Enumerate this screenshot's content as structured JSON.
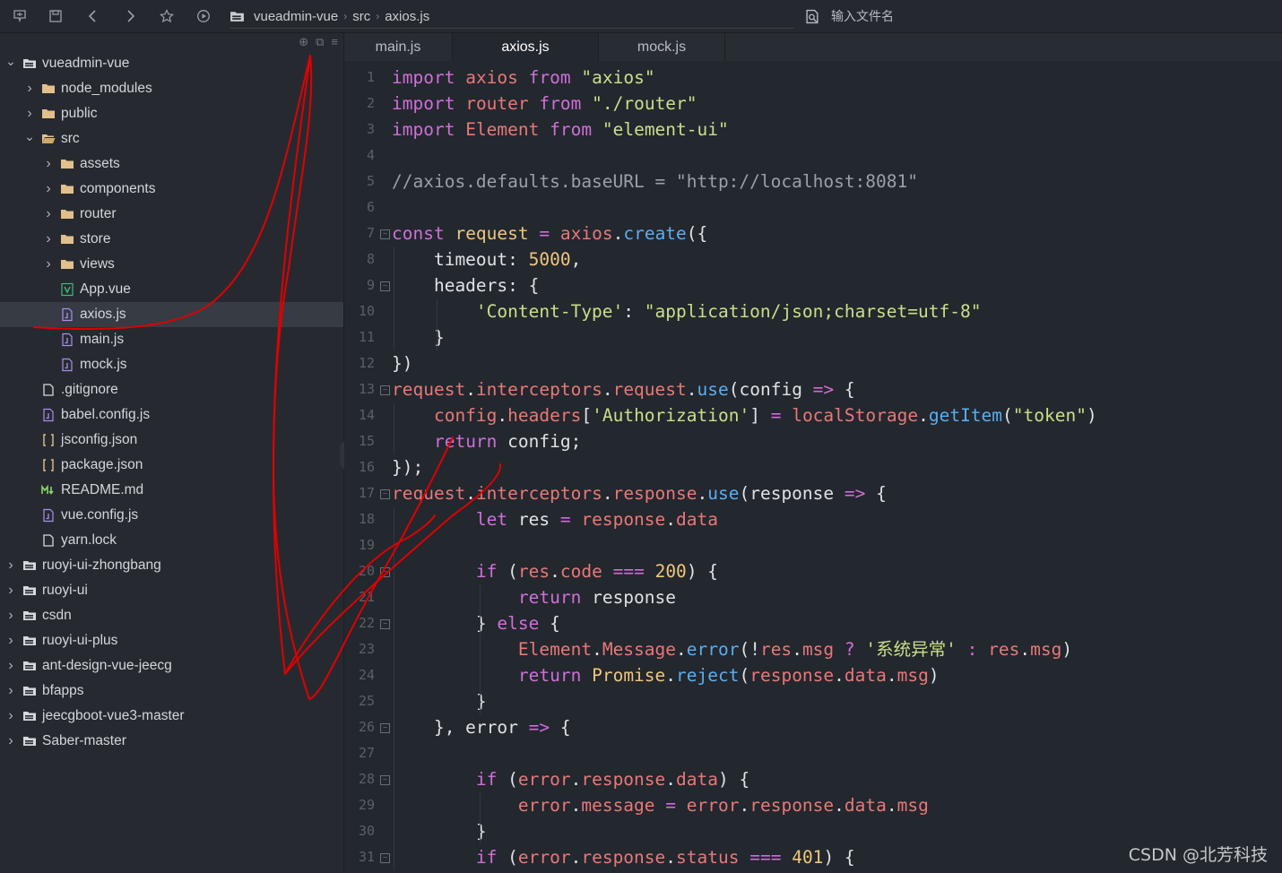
{
  "toolbar": {
    "path": [
      "vueadmin-vue",
      "src",
      "axios.js"
    ],
    "search_placeholder": "输入文件名"
  },
  "sidebar": {
    "tree": [
      {
        "label": "vueadmin-vue",
        "type": "project",
        "expanded": true,
        "level": 0
      },
      {
        "label": "node_modules",
        "type": "folder",
        "expanded": false,
        "level": 1
      },
      {
        "label": "public",
        "type": "folder",
        "expanded": false,
        "level": 1
      },
      {
        "label": "src",
        "type": "folder-open",
        "expanded": true,
        "level": 1
      },
      {
        "label": "assets",
        "type": "folder",
        "expanded": false,
        "level": 2
      },
      {
        "label": "components",
        "type": "folder",
        "expanded": false,
        "level": 2
      },
      {
        "label": "router",
        "type": "folder",
        "expanded": false,
        "level": 2
      },
      {
        "label": "store",
        "type": "folder",
        "expanded": false,
        "level": 2
      },
      {
        "label": "views",
        "type": "folder",
        "expanded": false,
        "level": 2
      },
      {
        "label": "App.vue",
        "type": "vue",
        "level": 2
      },
      {
        "label": "axios.js",
        "type": "js",
        "level": 2,
        "selected": true
      },
      {
        "label": "main.js",
        "type": "js",
        "level": 2
      },
      {
        "label": "mock.js",
        "type": "js",
        "level": 2
      },
      {
        "label": ".gitignore",
        "type": "file",
        "level": 1
      },
      {
        "label": "babel.config.js",
        "type": "js",
        "level": 1
      },
      {
        "label": "jsconfig.json",
        "type": "json",
        "level": 1
      },
      {
        "label": "package.json",
        "type": "json",
        "level": 1
      },
      {
        "label": "README.md",
        "type": "md",
        "level": 1
      },
      {
        "label": "vue.config.js",
        "type": "js",
        "level": 1
      },
      {
        "label": "yarn.lock",
        "type": "file",
        "level": 1
      },
      {
        "label": "ruoyi-ui-zhongbang",
        "type": "project",
        "expanded": false,
        "level": 0
      },
      {
        "label": "ruoyi-ui",
        "type": "project",
        "expanded": false,
        "level": 0
      },
      {
        "label": "csdn",
        "type": "project",
        "expanded": false,
        "level": 0
      },
      {
        "label": "ruoyi-ui-plus",
        "type": "project",
        "expanded": false,
        "level": 0
      },
      {
        "label": "ant-design-vue-jeecg",
        "type": "project",
        "expanded": false,
        "level": 0
      },
      {
        "label": "bfapps",
        "type": "project",
        "expanded": false,
        "level": 0
      },
      {
        "label": "jeecgboot-vue3-master",
        "type": "project",
        "expanded": false,
        "level": 0
      },
      {
        "label": "Saber-master",
        "type": "project",
        "expanded": false,
        "level": 0
      }
    ]
  },
  "tabs": [
    {
      "label": "main.js",
      "active": false
    },
    {
      "label": "axios.js",
      "active": true
    },
    {
      "label": "mock.js",
      "active": false
    }
  ],
  "code": {
    "lines": [
      {
        "n": "1",
        "fold": false,
        "tokens": [
          [
            "kw",
            "import"
          ],
          [
            "pl",
            " "
          ],
          [
            "vr",
            "axios"
          ],
          [
            "pl",
            " "
          ],
          [
            "fr",
            "from"
          ],
          [
            "pl",
            " "
          ],
          [
            "st",
            "\"axios\""
          ]
        ]
      },
      {
        "n": "2",
        "fold": false,
        "tokens": [
          [
            "kw",
            "import"
          ],
          [
            "pl",
            " "
          ],
          [
            "vr",
            "router"
          ],
          [
            "pl",
            " "
          ],
          [
            "fr",
            "from"
          ],
          [
            "pl",
            " "
          ],
          [
            "st",
            "\"./router\""
          ]
        ]
      },
      {
        "n": "3",
        "fold": false,
        "tokens": [
          [
            "kw",
            "import"
          ],
          [
            "pl",
            " "
          ],
          [
            "vr",
            "Element"
          ],
          [
            "pl",
            " "
          ],
          [
            "fr",
            "from"
          ],
          [
            "pl",
            " "
          ],
          [
            "st",
            "\"element-ui\""
          ]
        ]
      },
      {
        "n": "4",
        "fold": false,
        "tokens": []
      },
      {
        "n": "5",
        "fold": false,
        "tokens": [
          [
            "cm",
            "//axios.defaults.baseURL = \"http://localhost:8081\""
          ]
        ]
      },
      {
        "n": "6",
        "fold": false,
        "tokens": []
      },
      {
        "n": "7",
        "fold": true,
        "tokens": [
          [
            "kw",
            "const"
          ],
          [
            "pl",
            " "
          ],
          [
            "nm",
            "request"
          ],
          [
            "pl",
            " "
          ],
          [
            "op",
            "="
          ],
          [
            "pl",
            " "
          ],
          [
            "vr",
            "axios"
          ],
          [
            "pl",
            "."
          ],
          [
            "fn",
            "create"
          ],
          [
            "pl",
            "({"
          ]
        ]
      },
      {
        "n": "8",
        "fold": false,
        "tokens": [
          [
            "pl",
            "    timeout: "
          ],
          [
            "nm",
            "5000"
          ],
          [
            "pl",
            ","
          ]
        ]
      },
      {
        "n": "9",
        "fold": true,
        "tokens": [
          [
            "pl",
            "    headers: {"
          ]
        ]
      },
      {
        "n": "10",
        "fold": false,
        "tokens": [
          [
            "pl",
            "        "
          ],
          [
            "st",
            "'Content-Type'"
          ],
          [
            "pl",
            ": "
          ],
          [
            "st",
            "\"application/json;charset=utf-8\""
          ]
        ]
      },
      {
        "n": "11",
        "fold": false,
        "tokens": [
          [
            "pl",
            "    }"
          ]
        ]
      },
      {
        "n": "12",
        "fold": false,
        "tokens": [
          [
            "pl",
            "})"
          ]
        ]
      },
      {
        "n": "13",
        "fold": true,
        "tokens": [
          [
            "vr",
            "request"
          ],
          [
            "pl",
            "."
          ],
          [
            "vr",
            "interceptors"
          ],
          [
            "pl",
            "."
          ],
          [
            "vr",
            "request"
          ],
          [
            "pl",
            "."
          ],
          [
            "fn",
            "use"
          ],
          [
            "pl",
            "(config "
          ],
          [
            "op",
            "=>"
          ],
          [
            "pl",
            " {"
          ]
        ]
      },
      {
        "n": "14",
        "fold": false,
        "tokens": [
          [
            "pl",
            "    "
          ],
          [
            "vr",
            "config"
          ],
          [
            "pl",
            "."
          ],
          [
            "vr",
            "headers"
          ],
          [
            "pl",
            "["
          ],
          [
            "st",
            "'Authorization'"
          ],
          [
            "pl",
            "] "
          ],
          [
            "op",
            "="
          ],
          [
            "pl",
            " "
          ],
          [
            "vr",
            "localStorage"
          ],
          [
            "pl",
            "."
          ],
          [
            "fn",
            "getItem"
          ],
          [
            "pl",
            "("
          ],
          [
            "st",
            "\"token\""
          ],
          [
            "pl",
            ")"
          ]
        ]
      },
      {
        "n": "15",
        "fold": false,
        "tokens": [
          [
            "pl",
            "    "
          ],
          [
            "kw",
            "return"
          ],
          [
            "pl",
            " config;"
          ]
        ]
      },
      {
        "n": "16",
        "fold": false,
        "tokens": [
          [
            "pl",
            "});"
          ]
        ]
      },
      {
        "n": "17",
        "fold": true,
        "tokens": [
          [
            "vr",
            "request"
          ],
          [
            "pl",
            "."
          ],
          [
            "vr",
            "interceptors"
          ],
          [
            "pl",
            "."
          ],
          [
            "vr",
            "response"
          ],
          [
            "pl",
            "."
          ],
          [
            "fn",
            "use"
          ],
          [
            "pl",
            "(response "
          ],
          [
            "op",
            "=>"
          ],
          [
            "pl",
            " {"
          ]
        ]
      },
      {
        "n": "18",
        "fold": false,
        "tokens": [
          [
            "pl",
            "        "
          ],
          [
            "kw",
            "let"
          ],
          [
            "pl",
            " res "
          ],
          [
            "op",
            "="
          ],
          [
            "pl",
            " "
          ],
          [
            "vr",
            "response"
          ],
          [
            "pl",
            "."
          ],
          [
            "vr",
            "data"
          ]
        ]
      },
      {
        "n": "19",
        "fold": false,
        "tokens": []
      },
      {
        "n": "20",
        "fold": true,
        "tokens": [
          [
            "pl",
            "        "
          ],
          [
            "kw",
            "if"
          ],
          [
            "pl",
            " ("
          ],
          [
            "vr",
            "res"
          ],
          [
            "pl",
            "."
          ],
          [
            "vr",
            "code"
          ],
          [
            "pl",
            " "
          ],
          [
            "op",
            "==="
          ],
          [
            "pl",
            " "
          ],
          [
            "nm",
            "200"
          ],
          [
            "pl",
            ") {"
          ]
        ]
      },
      {
        "n": "21",
        "fold": false,
        "tokens": [
          [
            "pl",
            "            "
          ],
          [
            "kw",
            "return"
          ],
          [
            "pl",
            " response"
          ]
        ]
      },
      {
        "n": "22",
        "fold": true,
        "tokens": [
          [
            "pl",
            "        } "
          ],
          [
            "kw",
            "else"
          ],
          [
            "pl",
            " {"
          ]
        ]
      },
      {
        "n": "23",
        "fold": false,
        "tokens": [
          [
            "pl",
            "            "
          ],
          [
            "vr",
            "Element"
          ],
          [
            "pl",
            "."
          ],
          [
            "vr",
            "Message"
          ],
          [
            "pl",
            "."
          ],
          [
            "fn",
            "error"
          ],
          [
            "pl",
            "(!"
          ],
          [
            "vr",
            "res"
          ],
          [
            "pl",
            "."
          ],
          [
            "vr",
            "msg"
          ],
          [
            "pl",
            " "
          ],
          [
            "op",
            "?"
          ],
          [
            "pl",
            " "
          ],
          [
            "st",
            "'系统异常'"
          ],
          [
            "pl",
            " "
          ],
          [
            "op",
            ":"
          ],
          [
            "pl",
            " "
          ],
          [
            "vr",
            "res"
          ],
          [
            "pl",
            "."
          ],
          [
            "vr",
            "msg"
          ],
          [
            "pl",
            ")"
          ]
        ]
      },
      {
        "n": "24",
        "fold": false,
        "tokens": [
          [
            "pl",
            "            "
          ],
          [
            "kw",
            "return"
          ],
          [
            "pl",
            " "
          ],
          [
            "cl",
            "Promise"
          ],
          [
            "pl",
            "."
          ],
          [
            "fn",
            "reject"
          ],
          [
            "pl",
            "("
          ],
          [
            "vr",
            "response"
          ],
          [
            "pl",
            "."
          ],
          [
            "vr",
            "data"
          ],
          [
            "pl",
            "."
          ],
          [
            "vr",
            "msg"
          ],
          [
            "pl",
            ")"
          ]
        ]
      },
      {
        "n": "25",
        "fold": false,
        "tokens": [
          [
            "pl",
            "        }"
          ]
        ]
      },
      {
        "n": "26",
        "fold": true,
        "tokens": [
          [
            "pl",
            "    }, error "
          ],
          [
            "op",
            "=>"
          ],
          [
            "pl",
            " {"
          ]
        ]
      },
      {
        "n": "27",
        "fold": false,
        "tokens": []
      },
      {
        "n": "28",
        "fold": true,
        "tokens": [
          [
            "pl",
            "        "
          ],
          [
            "kw",
            "if"
          ],
          [
            "pl",
            " ("
          ],
          [
            "vr",
            "error"
          ],
          [
            "pl",
            "."
          ],
          [
            "vr",
            "response"
          ],
          [
            "pl",
            "."
          ],
          [
            "vr",
            "data"
          ],
          [
            "pl",
            ") {"
          ]
        ]
      },
      {
        "n": "29",
        "fold": false,
        "tokens": [
          [
            "pl",
            "            "
          ],
          [
            "vr",
            "error"
          ],
          [
            "pl",
            "."
          ],
          [
            "vr",
            "message"
          ],
          [
            "pl",
            " "
          ],
          [
            "op",
            "="
          ],
          [
            "pl",
            " "
          ],
          [
            "vr",
            "error"
          ],
          [
            "pl",
            "."
          ],
          [
            "vr",
            "response"
          ],
          [
            "pl",
            "."
          ],
          [
            "vr",
            "data"
          ],
          [
            "pl",
            "."
          ],
          [
            "vr",
            "msg"
          ]
        ]
      },
      {
        "n": "30",
        "fold": false,
        "tokens": [
          [
            "pl",
            "        }"
          ]
        ]
      },
      {
        "n": "31",
        "fold": true,
        "tokens": [
          [
            "pl",
            "        "
          ],
          [
            "kw",
            "if"
          ],
          [
            "pl",
            " ("
          ],
          [
            "vr",
            "error"
          ],
          [
            "pl",
            "."
          ],
          [
            "vr",
            "response"
          ],
          [
            "pl",
            "."
          ],
          [
            "vr",
            "status"
          ],
          [
            "pl",
            " "
          ],
          [
            "op",
            "==="
          ],
          [
            "pl",
            " "
          ],
          [
            "nm",
            "401"
          ],
          [
            "pl",
            ") {"
          ]
        ]
      }
    ]
  },
  "watermark": "CSDN @北芳科技",
  "colors": {
    "background": "#23272e",
    "keyword": "#cf6fd9",
    "variable": "#e87878",
    "string": "#c6e089",
    "number": "#efc67b",
    "function": "#5aaef0",
    "comment": "#9aa0a8",
    "annotation": "#e00000",
    "folder": "#e2c08d"
  }
}
